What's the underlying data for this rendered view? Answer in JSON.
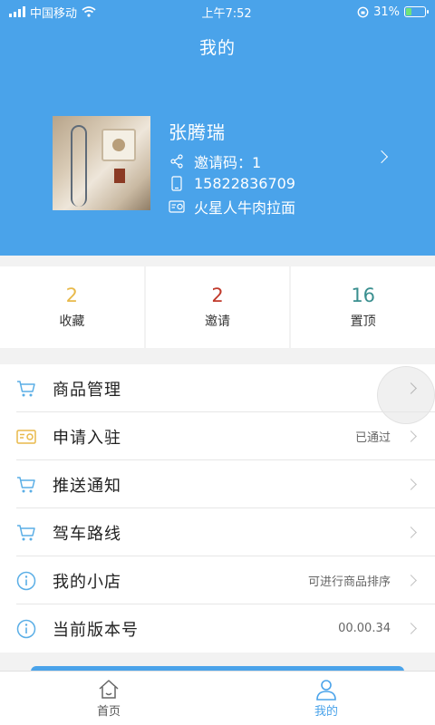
{
  "status_bar": {
    "carrier": "中国移动",
    "time": "上午7:52",
    "battery": "31%",
    "battery_level": 0.31
  },
  "header": {
    "title": "我的"
  },
  "profile": {
    "name": "张腾瑞",
    "invite_code": "邀请码：1",
    "phone": "15822836709",
    "shop": "火星人牛肉拉面"
  },
  "stats": [
    {
      "value": "2",
      "label": "收藏",
      "color": "#e8b94a"
    },
    {
      "value": "2",
      "label": "邀请",
      "color": "#c0392b"
    },
    {
      "value": "16",
      "label": "置顶",
      "color": "#3a8f8f"
    }
  ],
  "menu": [
    {
      "label": "商品管理",
      "value": "",
      "icon": "cart-icon"
    },
    {
      "label": "申请入驻",
      "value": "已通过",
      "icon": "card-icon"
    },
    {
      "label": "推送通知",
      "value": "",
      "icon": "cart-icon"
    },
    {
      "label": "驾车路线",
      "value": "",
      "icon": "cart-icon"
    },
    {
      "label": "我的小店",
      "value": "可进行商品排序",
      "icon": "info-icon"
    },
    {
      "label": "当前版本号",
      "value": "00.00.34",
      "icon": "info-icon"
    }
  ],
  "tabs": [
    {
      "label": "首页",
      "icon": "home-icon",
      "active": false
    },
    {
      "label": "我的",
      "icon": "person-icon",
      "active": true
    }
  ],
  "colors": {
    "brand": "#4aa3ea",
    "icon_blue": "#5aaee6",
    "icon_yellow": "#e8b94a"
  }
}
